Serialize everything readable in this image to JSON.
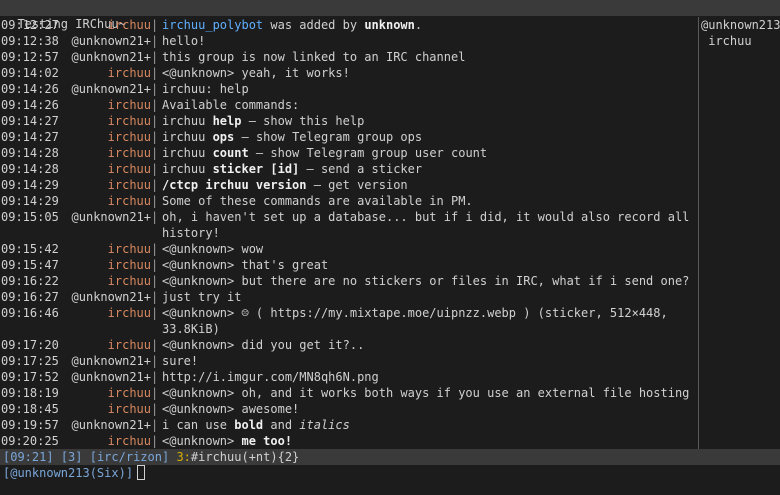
{
  "window": {
    "title": "Testing IRChuu~"
  },
  "messages": [
    {
      "time": "09:12:27",
      "nick": "irchuu",
      "text": "",
      "parts": [
        {
          "t": "irchuu_polybot",
          "c": "hl-nick"
        },
        {
          "t": " was added by "
        },
        {
          "t": "unknown",
          "c": "b"
        },
        {
          "t": "."
        }
      ]
    },
    {
      "time": "09:12:38",
      "nick": "@unknown21+",
      "parts": [
        {
          "t": "hello!"
        }
      ]
    },
    {
      "time": "09:12:57",
      "nick": "@unknown21+",
      "parts": [
        {
          "t": "this group is now linked to an IRC channel"
        }
      ]
    },
    {
      "time": "09:14:02",
      "nick": "irchuu",
      "parts": [
        {
          "t": "<@unknown> yeah, it works!"
        }
      ]
    },
    {
      "time": "09:14:26",
      "nick": "@unknown21+",
      "parts": [
        {
          "t": "irchuu: help"
        }
      ]
    },
    {
      "time": "09:14:26",
      "nick": "irchuu",
      "parts": [
        {
          "t": "Available commands:"
        }
      ]
    },
    {
      "time": "09:14:27",
      "nick": "irchuu",
      "parts": [
        {
          "t": "irchuu "
        },
        {
          "t": "help",
          "c": "b"
        },
        {
          "t": " — show this help"
        }
      ]
    },
    {
      "time": "09:14:27",
      "nick": "irchuu",
      "parts": [
        {
          "t": "irchuu "
        },
        {
          "t": "ops",
          "c": "b"
        },
        {
          "t": " — show Telegram group ops"
        }
      ]
    },
    {
      "time": "09:14:28",
      "nick": "irchuu",
      "parts": [
        {
          "t": "irchuu "
        },
        {
          "t": "count",
          "c": "b"
        },
        {
          "t": " — show Telegram group user count"
        }
      ]
    },
    {
      "time": "09:14:28",
      "nick": "irchuu",
      "parts": [
        {
          "t": "irchuu "
        },
        {
          "t": "sticker [id]",
          "c": "b"
        },
        {
          "t": " — send a sticker"
        }
      ]
    },
    {
      "time": "09:14:29",
      "nick": "irchuu",
      "parts": [
        {
          "t": "/ctcp irchuu version",
          "c": "b"
        },
        {
          "t": " — get version"
        }
      ]
    },
    {
      "time": "09:14:29",
      "nick": "irchuu",
      "parts": [
        {
          "t": "Some of these commands are available in PM."
        }
      ]
    },
    {
      "time": "09:15:05",
      "nick": "@unknown21+",
      "parts": [
        {
          "t": "oh, i haven't set up a database... but if i did, it would also record all\nhistory!"
        }
      ]
    },
    {
      "time": "09:15:42",
      "nick": "irchuu",
      "parts": [
        {
          "t": "<@unknown> wow"
        }
      ]
    },
    {
      "time": "09:15:47",
      "nick": "irchuu",
      "parts": [
        {
          "t": "<@unknown> that's great"
        }
      ]
    },
    {
      "time": "09:16:22",
      "nick": "irchuu",
      "parts": [
        {
          "t": "<@unknown> but there are no stickers or files in IRC, what if i send one?"
        }
      ]
    },
    {
      "time": "09:16:27",
      "nick": "@unknown21+",
      "parts": [
        {
          "t": "just try it"
        }
      ]
    },
    {
      "time": "09:16:46",
      "nick": "irchuu",
      "parts": [
        {
          "t": "<@unknown> ☹ ( https://my.mixtape.moe/uipnzz.webp ) (sticker, 512×448,\n33.8KiB)"
        }
      ]
    },
    {
      "time": "09:17:20",
      "nick": "irchuu",
      "parts": [
        {
          "t": "<@unknown> did you get it?.."
        }
      ]
    },
    {
      "time": "09:17:25",
      "nick": "@unknown21+",
      "parts": [
        {
          "t": "sure!"
        }
      ]
    },
    {
      "time": "09:17:52",
      "nick": "@unknown21+",
      "parts": [
        {
          "t": "http://i.imgur.com/MN8qh6N.png"
        }
      ]
    },
    {
      "time": "09:18:19",
      "nick": "irchuu",
      "parts": [
        {
          "t": "<@unknown> oh, and it works both ways if you use an external file hosting"
        }
      ]
    },
    {
      "time": "09:18:45",
      "nick": "irchuu",
      "parts": [
        {
          "t": "<@unknown> awesome!"
        }
      ]
    },
    {
      "time": "09:19:57",
      "nick": "@unknown21+",
      "parts": [
        {
          "t": "i can use "
        },
        {
          "t": "bold",
          "c": "b"
        },
        {
          "t": " and "
        },
        {
          "t": "italics",
          "c": "i"
        }
      ]
    },
    {
      "time": "09:20:25",
      "nick": "irchuu",
      "parts": [
        {
          "t": "<@unknown> "
        },
        {
          "t": "me too!",
          "c": "b"
        }
      ]
    }
  ],
  "nicklist": [
    "@unknown213",
    " irchuu"
  ],
  "status": {
    "time": "[09:21]",
    "win": "[3]",
    "net": "[irc/rizon]",
    "act": "3:",
    "chan": "#irchuu(+nt){2}"
  },
  "input": {
    "prompt": "[@unknown213(Six)]"
  }
}
